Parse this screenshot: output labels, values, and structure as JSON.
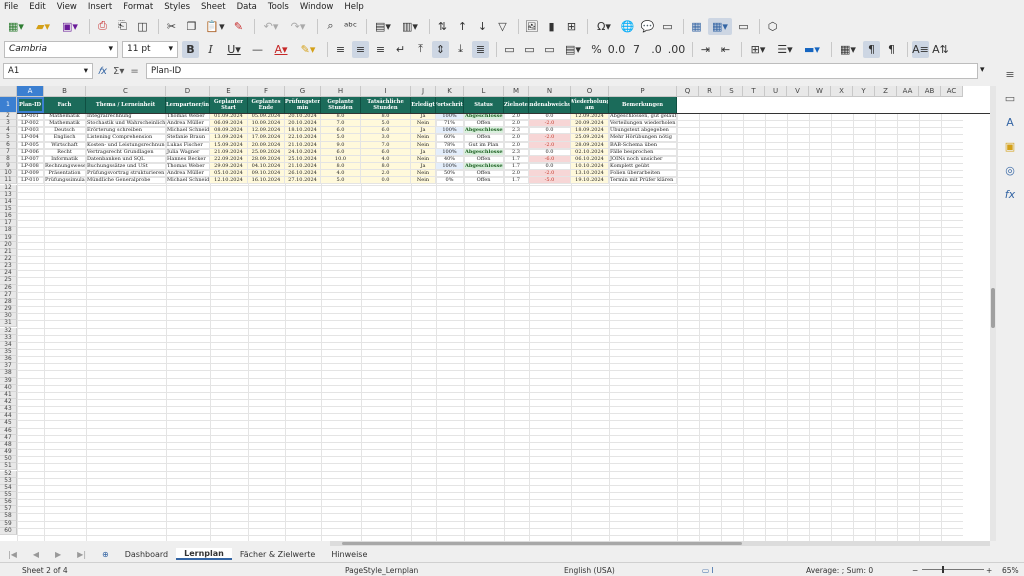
{
  "menu": [
    "File",
    "Edit",
    "View",
    "Insert",
    "Format",
    "Styles",
    "Sheet",
    "Data",
    "Tools",
    "Window",
    "Help"
  ],
  "toolbar": {
    "font_name": "Cambria",
    "font_size": "11 pt"
  },
  "formula_bar": {
    "name_box": "A1",
    "content": "Plan-ID"
  },
  "columns": [
    "A",
    "B",
    "C",
    "D",
    "E",
    "F",
    "G",
    "H",
    "I",
    "J",
    "K",
    "L",
    "M",
    "N",
    "O",
    "P",
    "Q",
    "R",
    "S",
    "T",
    "U",
    "V",
    "W",
    "X",
    "Y",
    "Z",
    "AA",
    "AB",
    "AC"
  ],
  "headers": [
    "Plan-ID",
    "Fach",
    "Thema / Lerneinheit",
    "Lernpartner/in",
    "Geplanter Start",
    "Geplantes Ende",
    "Prüfungster min",
    "Geplante Stunden",
    "Tatsächliche Stunden",
    "Erledigt",
    "Fortschritt",
    "Status",
    "Zielnote",
    "Stundenabweichung",
    "Wiederholung am",
    "Bemerkungen"
  ],
  "rows": [
    [
      "LP-001",
      "Mathematik",
      "Integralrechnung",
      "Thomas Weber",
      "01.09.2024",
      "05.09.2024",
      "20.10.2024",
      "8.0",
      "8.0",
      "Ja",
      "100%",
      "Abgeschlossen",
      "2.0",
      "0.0",
      "12.09.2024",
      "Abgeschlossen, gut gelaufen"
    ],
    [
      "LP-002",
      "Mathematik",
      "Stochastik und Wahrscheinlichkeit",
      "Andrea Müller",
      "06.09.2024",
      "10.09.2024",
      "20.10.2024",
      "7.0",
      "5.0",
      "Nein",
      "71%",
      "Offen",
      "2.0",
      "-2.0",
      "20.09.2024",
      "Verteilungen wiederholen"
    ],
    [
      "LP-003",
      "Deutsch",
      "Erörterung schreiben",
      "Michael Schneider",
      "08.09.2024",
      "12.09.2024",
      "18.10.2024",
      "6.0",
      "6.0",
      "Ja",
      "100%",
      "Abgeschlossen",
      "2.3",
      "0.0",
      "18.09.2024",
      "Übungstext abgegeben"
    ],
    [
      "LP-004",
      "Englisch",
      "Listening Comprehension",
      "Stefanie Braun",
      "13.09.2024",
      "17.09.2024",
      "22.10.2024",
      "5.0",
      "3.0",
      "Nein",
      "60%",
      "Offen",
      "2.0",
      "-2.0",
      "25.09.2024",
      "Mehr Hörübungen nötig"
    ],
    [
      "LP-005",
      "Wirtschaft",
      "Kosten- und Leistungsrechnung",
      "Lukas Fischer",
      "15.09.2024",
      "20.09.2024",
      "21.10.2024",
      "9.0",
      "7.0",
      "Nein",
      "78%",
      "Gut im Plan",
      "2.0",
      "-2.0",
      "28.09.2024",
      "BAB-Schema üben"
    ],
    [
      "LP-006",
      "Recht",
      "Vertragsrecht Grundlagen",
      "Julia Wagner",
      "21.09.2024",
      "25.09.2024",
      "24.10.2024",
      "6.0",
      "6.0",
      "Ja",
      "100%",
      "Abgeschlossen",
      "2.3",
      "0.0",
      "02.10.2024",
      "Fälle besprochen"
    ],
    [
      "LP-007",
      "Informatik",
      "Datenbanken und SQL",
      "Hannes Becker",
      "22.09.2024",
      "28.09.2024",
      "25.10.2024",
      "10.0",
      "4.0",
      "Nein",
      "40%",
      "Offen",
      "1.7",
      "-6.0",
      "06.10.2024",
      "JOINs noch unsicher"
    ],
    [
      "LP-008",
      "Rechnungswesen",
      "Buchungssätze und USt",
      "Thomas Weber",
      "29.09.2024",
      "04.10.2024",
      "21.10.2024",
      "8.0",
      "8.0",
      "Ja",
      "100%",
      "Abgeschlossen",
      "1.7",
      "0.0",
      "10.10.2024",
      "Komplett geübt"
    ],
    [
      "LP-009",
      "Präsentation",
      "Prüfungsvortrag strukturieren",
      "Andrea Müller",
      "05.10.2024",
      "09.10.2024",
      "26.10.2024",
      "4.0",
      "2.0",
      "Nein",
      "50%",
      "Offen",
      "2.0",
      "-2.0",
      "13.10.2024",
      "Folien überarbeiten"
    ],
    [
      "LP-010",
      "Prüfungssimulation",
      "Mündliche Generalprobe",
      "Michael Schneider",
      "12.10.2024",
      "16.10.2024",
      "27.10.2024",
      "5.0",
      "0.0",
      "Nein",
      "0%",
      "Offen",
      "1.7",
      "-5.0",
      "19.10.2024",
      "Termin mit Prüfer klären"
    ]
  ],
  "sheet_tabs": [
    "Dashboard",
    "Lernplan",
    "Fächer & Zielwerte",
    "Hinweise"
  ],
  "active_tab": "Lernplan",
  "status": {
    "sheet_info": "Sheet 2 of 4",
    "page_style": "PageStyle_Lernplan",
    "language": "English (USA)",
    "summary": "Average: ; Sum: 0",
    "zoom": "65%"
  },
  "colors": {
    "header_bg": "#1b6b5a",
    "selection": "#3b7fd1",
    "status_done": "#1b5e20",
    "negative": "#c0392b"
  }
}
